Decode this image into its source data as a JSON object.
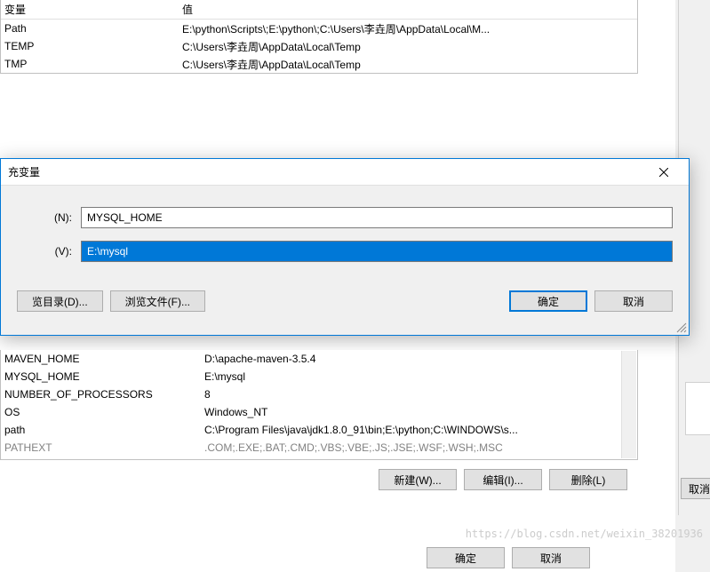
{
  "upperTable": {
    "headers": [
      "变量",
      "值"
    ],
    "rows": [
      {
        "name": "Path",
        "value": "E:\\python\\Scripts\\;E:\\python\\;C:\\Users\\李垚周\\AppData\\Local\\M..."
      },
      {
        "name": "TEMP",
        "value": "C:\\Users\\李垚周\\AppData\\Local\\Temp"
      },
      {
        "name": "TMP",
        "value": "C:\\Users\\李垚周\\AppData\\Local\\Temp"
      }
    ]
  },
  "dialog": {
    "title": "充变量",
    "labelName": "(N):",
    "labelValue": "(V):",
    "name": "MYSQL_HOME",
    "value": "E:\\mysql",
    "browseDir": "览目录(D)...",
    "browseFile": "浏览文件(F)...",
    "ok": "确定",
    "cancel": "取消"
  },
  "lowerTable": {
    "rows": [
      {
        "name": "MAVEN_HOME",
        "value": "D:\\apache-maven-3.5.4"
      },
      {
        "name": "MYSQL_HOME",
        "value": "E:\\mysql"
      },
      {
        "name": "NUMBER_OF_PROCESSORS",
        "value": "8"
      },
      {
        "name": "OS",
        "value": "Windows_NT"
      },
      {
        "name": "path",
        "value": "C:\\Program Files\\java\\jdk1.8.0_91\\bin;E:\\python;C:\\WINDOWS\\s..."
      },
      {
        "name": "PATHEXT",
        "value": ".COM;.EXE;.BAT;.CMD;.VBS;.VBE;.JS;.JSE;.WSF;.WSH;.MSC"
      }
    ]
  },
  "lowerButtons": {
    "new": "新建(W)...",
    "edit": "编辑(I)...",
    "delete": "删除(L)"
  },
  "bottomButtons": {
    "ok": "确定",
    "cancel": "取消"
  },
  "rightCancel": "取消",
  "watermark": "https://blog.csdn.net/weixin_38201936"
}
